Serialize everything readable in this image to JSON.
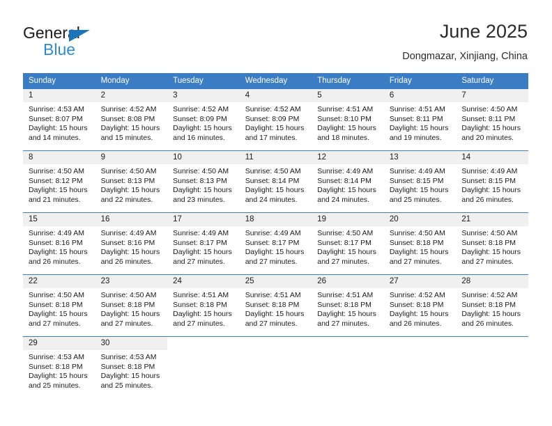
{
  "brand": {
    "name_top": "General",
    "name_bottom": "Blue",
    "triangle_color": "#1b75bb",
    "blue_color": "#2e8ad4"
  },
  "header": {
    "title": "June 2025",
    "subtitle": "Dongmazar, Xinjiang, China"
  },
  "theme": {
    "header_row_bg": "#3b7dc4",
    "daynum_bg": "#f0f0f0",
    "text_color": "#1a1a1a"
  },
  "columns": [
    "Sunday",
    "Monday",
    "Tuesday",
    "Wednesday",
    "Thursday",
    "Friday",
    "Saturday"
  ],
  "weeks": [
    [
      {
        "day": "1",
        "sunrise": "Sunrise: 4:53 AM",
        "sunset": "Sunset: 8:07 PM",
        "daylight1": "Daylight: 15 hours",
        "daylight2": "and 14 minutes."
      },
      {
        "day": "2",
        "sunrise": "Sunrise: 4:52 AM",
        "sunset": "Sunset: 8:08 PM",
        "daylight1": "Daylight: 15 hours",
        "daylight2": "and 15 minutes."
      },
      {
        "day": "3",
        "sunrise": "Sunrise: 4:52 AM",
        "sunset": "Sunset: 8:09 PM",
        "daylight1": "Daylight: 15 hours",
        "daylight2": "and 16 minutes."
      },
      {
        "day": "4",
        "sunrise": "Sunrise: 4:52 AM",
        "sunset": "Sunset: 8:09 PM",
        "daylight1": "Daylight: 15 hours",
        "daylight2": "and 17 minutes."
      },
      {
        "day": "5",
        "sunrise": "Sunrise: 4:51 AM",
        "sunset": "Sunset: 8:10 PM",
        "daylight1": "Daylight: 15 hours",
        "daylight2": "and 18 minutes."
      },
      {
        "day": "6",
        "sunrise": "Sunrise: 4:51 AM",
        "sunset": "Sunset: 8:11 PM",
        "daylight1": "Daylight: 15 hours",
        "daylight2": "and 19 minutes."
      },
      {
        "day": "7",
        "sunrise": "Sunrise: 4:50 AM",
        "sunset": "Sunset: 8:11 PM",
        "daylight1": "Daylight: 15 hours",
        "daylight2": "and 20 minutes."
      }
    ],
    [
      {
        "day": "8",
        "sunrise": "Sunrise: 4:50 AM",
        "sunset": "Sunset: 8:12 PM",
        "daylight1": "Daylight: 15 hours",
        "daylight2": "and 21 minutes."
      },
      {
        "day": "9",
        "sunrise": "Sunrise: 4:50 AM",
        "sunset": "Sunset: 8:13 PM",
        "daylight1": "Daylight: 15 hours",
        "daylight2": "and 22 minutes."
      },
      {
        "day": "10",
        "sunrise": "Sunrise: 4:50 AM",
        "sunset": "Sunset: 8:13 PM",
        "daylight1": "Daylight: 15 hours",
        "daylight2": "and 23 minutes."
      },
      {
        "day": "11",
        "sunrise": "Sunrise: 4:50 AM",
        "sunset": "Sunset: 8:14 PM",
        "daylight1": "Daylight: 15 hours",
        "daylight2": "and 24 minutes."
      },
      {
        "day": "12",
        "sunrise": "Sunrise: 4:49 AM",
        "sunset": "Sunset: 8:14 PM",
        "daylight1": "Daylight: 15 hours",
        "daylight2": "and 24 minutes."
      },
      {
        "day": "13",
        "sunrise": "Sunrise: 4:49 AM",
        "sunset": "Sunset: 8:15 PM",
        "daylight1": "Daylight: 15 hours",
        "daylight2": "and 25 minutes."
      },
      {
        "day": "14",
        "sunrise": "Sunrise: 4:49 AM",
        "sunset": "Sunset: 8:15 PM",
        "daylight1": "Daylight: 15 hours",
        "daylight2": "and 26 minutes."
      }
    ],
    [
      {
        "day": "15",
        "sunrise": "Sunrise: 4:49 AM",
        "sunset": "Sunset: 8:16 PM",
        "daylight1": "Daylight: 15 hours",
        "daylight2": "and 26 minutes."
      },
      {
        "day": "16",
        "sunrise": "Sunrise: 4:49 AM",
        "sunset": "Sunset: 8:16 PM",
        "daylight1": "Daylight: 15 hours",
        "daylight2": "and 26 minutes."
      },
      {
        "day": "17",
        "sunrise": "Sunrise: 4:49 AM",
        "sunset": "Sunset: 8:17 PM",
        "daylight1": "Daylight: 15 hours",
        "daylight2": "and 27 minutes."
      },
      {
        "day": "18",
        "sunrise": "Sunrise: 4:49 AM",
        "sunset": "Sunset: 8:17 PM",
        "daylight1": "Daylight: 15 hours",
        "daylight2": "and 27 minutes."
      },
      {
        "day": "19",
        "sunrise": "Sunrise: 4:50 AM",
        "sunset": "Sunset: 8:17 PM",
        "daylight1": "Daylight: 15 hours",
        "daylight2": "and 27 minutes."
      },
      {
        "day": "20",
        "sunrise": "Sunrise: 4:50 AM",
        "sunset": "Sunset: 8:18 PM",
        "daylight1": "Daylight: 15 hours",
        "daylight2": "and 27 minutes."
      },
      {
        "day": "21",
        "sunrise": "Sunrise: 4:50 AM",
        "sunset": "Sunset: 8:18 PM",
        "daylight1": "Daylight: 15 hours",
        "daylight2": "and 27 minutes."
      }
    ],
    [
      {
        "day": "22",
        "sunrise": "Sunrise: 4:50 AM",
        "sunset": "Sunset: 8:18 PM",
        "daylight1": "Daylight: 15 hours",
        "daylight2": "and 27 minutes."
      },
      {
        "day": "23",
        "sunrise": "Sunrise: 4:50 AM",
        "sunset": "Sunset: 8:18 PM",
        "daylight1": "Daylight: 15 hours",
        "daylight2": "and 27 minutes."
      },
      {
        "day": "24",
        "sunrise": "Sunrise: 4:51 AM",
        "sunset": "Sunset: 8:18 PM",
        "daylight1": "Daylight: 15 hours",
        "daylight2": "and 27 minutes."
      },
      {
        "day": "25",
        "sunrise": "Sunrise: 4:51 AM",
        "sunset": "Sunset: 8:18 PM",
        "daylight1": "Daylight: 15 hours",
        "daylight2": "and 27 minutes."
      },
      {
        "day": "26",
        "sunrise": "Sunrise: 4:51 AM",
        "sunset": "Sunset: 8:18 PM",
        "daylight1": "Daylight: 15 hours",
        "daylight2": "and 27 minutes."
      },
      {
        "day": "27",
        "sunrise": "Sunrise: 4:52 AM",
        "sunset": "Sunset: 8:18 PM",
        "daylight1": "Daylight: 15 hours",
        "daylight2": "and 26 minutes."
      },
      {
        "day": "28",
        "sunrise": "Sunrise: 4:52 AM",
        "sunset": "Sunset: 8:18 PM",
        "daylight1": "Daylight: 15 hours",
        "daylight2": "and 26 minutes."
      }
    ],
    [
      {
        "day": "29",
        "sunrise": "Sunrise: 4:53 AM",
        "sunset": "Sunset: 8:18 PM",
        "daylight1": "Daylight: 15 hours",
        "daylight2": "and 25 minutes."
      },
      {
        "day": "30",
        "sunrise": "Sunrise: 4:53 AM",
        "sunset": "Sunset: 8:18 PM",
        "daylight1": "Daylight: 15 hours",
        "daylight2": "and 25 minutes."
      },
      {
        "day": "",
        "sunrise": "",
        "sunset": "",
        "daylight1": "",
        "daylight2": ""
      },
      {
        "day": "",
        "sunrise": "",
        "sunset": "",
        "daylight1": "",
        "daylight2": ""
      },
      {
        "day": "",
        "sunrise": "",
        "sunset": "",
        "daylight1": "",
        "daylight2": ""
      },
      {
        "day": "",
        "sunrise": "",
        "sunset": "",
        "daylight1": "",
        "daylight2": ""
      },
      {
        "day": "",
        "sunrise": "",
        "sunset": "",
        "daylight1": "",
        "daylight2": ""
      }
    ]
  ]
}
